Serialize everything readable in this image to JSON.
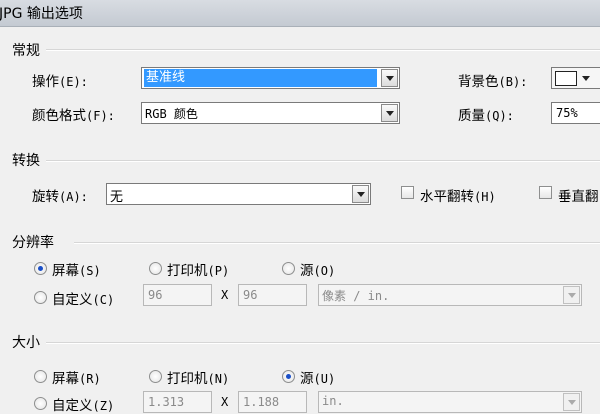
{
  "window": {
    "title": "JPG 输出选项"
  },
  "general": {
    "heading": "常规",
    "operation": {
      "label": "操作",
      "key": "(E):",
      "value": "基准线"
    },
    "color_format": {
      "label": "颜色格式",
      "key": "(F):",
      "value": "RGB 颜色"
    },
    "background": {
      "label": "背景色",
      "key": "(B):",
      "swatch": "#ffffff"
    },
    "quality": {
      "label": "质量",
      "key": "(Q):",
      "value": "75%"
    }
  },
  "transform": {
    "heading": "转换",
    "rotate": {
      "label": "旋转",
      "key": "(A):",
      "value": "无"
    },
    "flip_h": {
      "label": "水平翻转",
      "key": "(H)"
    },
    "flip_v": {
      "label": "垂直翻"
    }
  },
  "resolution": {
    "heading": "分辨率",
    "options": [
      {
        "label": "屏幕",
        "key": "(S)"
      },
      {
        "label": "打印机",
        "key": "(P)"
      },
      {
        "label": "源",
        "key": "(O)"
      }
    ],
    "custom": {
      "label": "自定义",
      "key": "(C)",
      "x": "96",
      "y": "96",
      "unit": "像素 / in."
    },
    "separator": "X"
  },
  "size": {
    "heading": "大小",
    "options": [
      {
        "label": "屏幕",
        "key": "(R)"
      },
      {
        "label": "打印机",
        "key": "(N)"
      },
      {
        "label": "源",
        "key": "(U)"
      }
    ],
    "custom": {
      "label": "自定义",
      "key": "(Z)",
      "x": "1.313",
      "y": "1.188",
      "unit": "in."
    },
    "separator": "X"
  }
}
